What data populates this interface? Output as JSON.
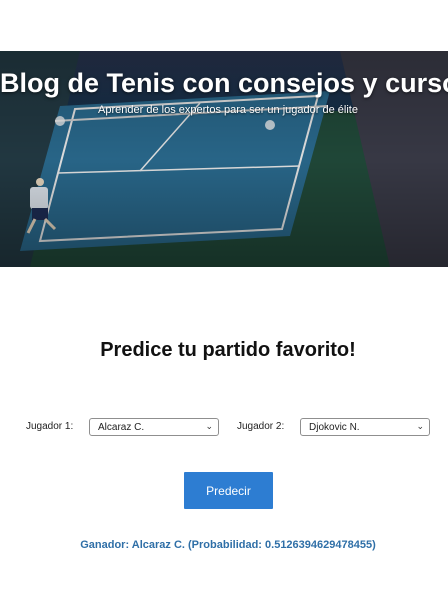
{
  "hero": {
    "title": "Blog de Tenis con consejos y cursos",
    "subtitle": "Aprender de los expertos para ser un jugador de élite"
  },
  "predict": {
    "title": "Predice tu partido favorito!",
    "player1_label": "Jugador 1:",
    "player1_value": "Alcaraz C.",
    "player2_label": "Jugador 2:",
    "player2_value": "Djokovic N.",
    "button_label": "Predecir",
    "result": "Ganador: Alcaraz C. (Probabilidad: 0.5126394629478455)"
  },
  "colors": {
    "button": "#2d7dd2",
    "result_text": "#2f6fa7",
    "court": "#1e4436"
  }
}
